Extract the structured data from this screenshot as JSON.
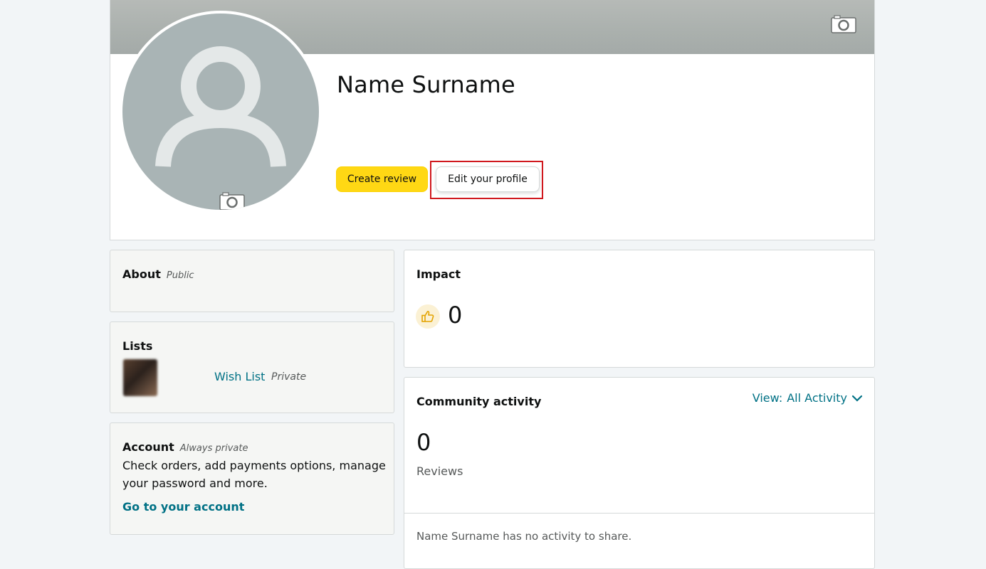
{
  "profile": {
    "name": "Name Surname",
    "location": "",
    "create_review_label": "Create review",
    "edit_profile_label": "Edit your profile"
  },
  "about": {
    "title": "About",
    "privacy": "Public"
  },
  "lists": {
    "title": "Lists",
    "wishlist_owner": "",
    "wishlist_name": "Wish List",
    "wishlist_privacy": "Private"
  },
  "account": {
    "title": "Account",
    "privacy": "Always private",
    "description": "Check orders, add payments options, manage your password and more.",
    "link": "Go to your account"
  },
  "impact": {
    "title": "Impact",
    "count": "0"
  },
  "community": {
    "title": "Community activity",
    "view_label": "View:",
    "view_value": "All Activity",
    "review_count": "0",
    "reviews_label": "Reviews",
    "empty_message": "Name Surname has no activity to share."
  },
  "colors": {
    "primary_button": "#ffd814",
    "link": "#007185",
    "highlight": "#d0181e"
  },
  "icons": [
    "camera-icon",
    "thumbs-up-icon",
    "chevron-down-icon",
    "avatar-placeholder-icon"
  ]
}
